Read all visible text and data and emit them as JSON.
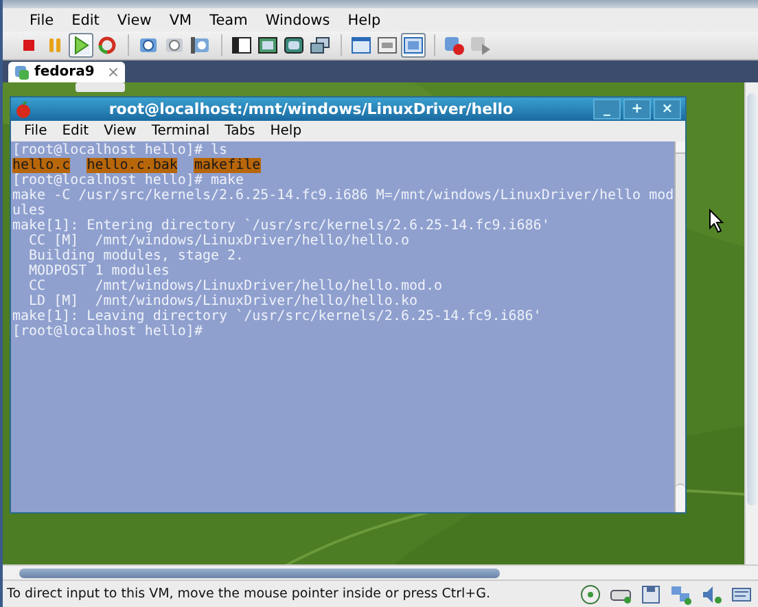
{
  "menu": [
    "File",
    "Edit",
    "View",
    "VM",
    "Team",
    "Windows",
    "Help"
  ],
  "toolbar": [
    {
      "kind": "stop",
      "pressed": false
    },
    {
      "kind": "pause",
      "pressed": false
    },
    {
      "kind": "play",
      "pressed": true
    },
    {
      "kind": "reset",
      "pressed": false
    },
    {
      "kind": "sep"
    },
    {
      "kind": "snapshot",
      "pressed": false
    },
    {
      "kind": "revert",
      "pressed": false
    },
    {
      "kind": "manage",
      "pressed": false
    },
    {
      "kind": "sep"
    },
    {
      "kind": "sidebar",
      "pressed": false
    },
    {
      "kind": "fullscreen",
      "pressed": false
    },
    {
      "kind": "unity",
      "pressed": false
    },
    {
      "kind": "windows",
      "pressed": false
    },
    {
      "kind": "sep"
    },
    {
      "kind": "console",
      "pressed": false
    },
    {
      "kind": "summary",
      "pressed": false
    },
    {
      "kind": "view",
      "pressed": true
    },
    {
      "kind": "sep"
    },
    {
      "kind": "record",
      "pressed": false
    },
    {
      "kind": "replay",
      "pressed": false
    }
  ],
  "tabs": [
    {
      "label": "fedora9",
      "selected": true,
      "close": "×"
    }
  ],
  "terminal": {
    "title": "root@localhost:/mnt/windows/LinuxDriver/hello",
    "controls": [
      "_",
      "+",
      "×"
    ],
    "menu": [
      "File",
      "Edit",
      "View",
      "Terminal",
      "Tabs",
      "Help"
    ],
    "lines": [
      {
        "kind": "text",
        "text": "[root@localhost hello]# ls"
      },
      {
        "kind": "files",
        "files": [
          "hello.c",
          "hello.c.bak",
          "makefile"
        ]
      },
      {
        "kind": "text",
        "text": "[root@localhost hello]# make"
      },
      {
        "kind": "text",
        "text": "make -C /usr/src/kernels/2.6.25-14.fc9.i686 M=/mnt/windows/LinuxDriver/hello mod"
      },
      {
        "kind": "text",
        "text": "ules"
      },
      {
        "kind": "text",
        "text": "make[1]: Entering directory `/usr/src/kernels/2.6.25-14.fc9.i686'"
      },
      {
        "kind": "text",
        "text": "  CC [M]  /mnt/windows/LinuxDriver/hello/hello.o"
      },
      {
        "kind": "text",
        "text": "  Building modules, stage 2."
      },
      {
        "kind": "text",
        "text": "  MODPOST 1 modules"
      },
      {
        "kind": "text",
        "text": "  CC      /mnt/windows/LinuxDriver/hello/hello.mod.o"
      },
      {
        "kind": "text",
        "text": "  LD [M]  /mnt/windows/LinuxDriver/hello/hello.ko"
      },
      {
        "kind": "text",
        "text": "make[1]: Leaving directory `/usr/src/kernels/2.6.25-14.fc9.i686'"
      },
      {
        "kind": "prompt",
        "text": "[root@localhost hello]#"
      }
    ]
  },
  "status_bar": {
    "message": "To direct input to this VM, move the mouse pointer inside or press Ctrl+G.",
    "devices": [
      {
        "kind": "cd"
      },
      {
        "kind": "hdd"
      },
      {
        "kind": "floppy"
      },
      {
        "kind": "network"
      },
      {
        "kind": "sound"
      },
      {
        "kind": "messages"
      }
    ]
  }
}
